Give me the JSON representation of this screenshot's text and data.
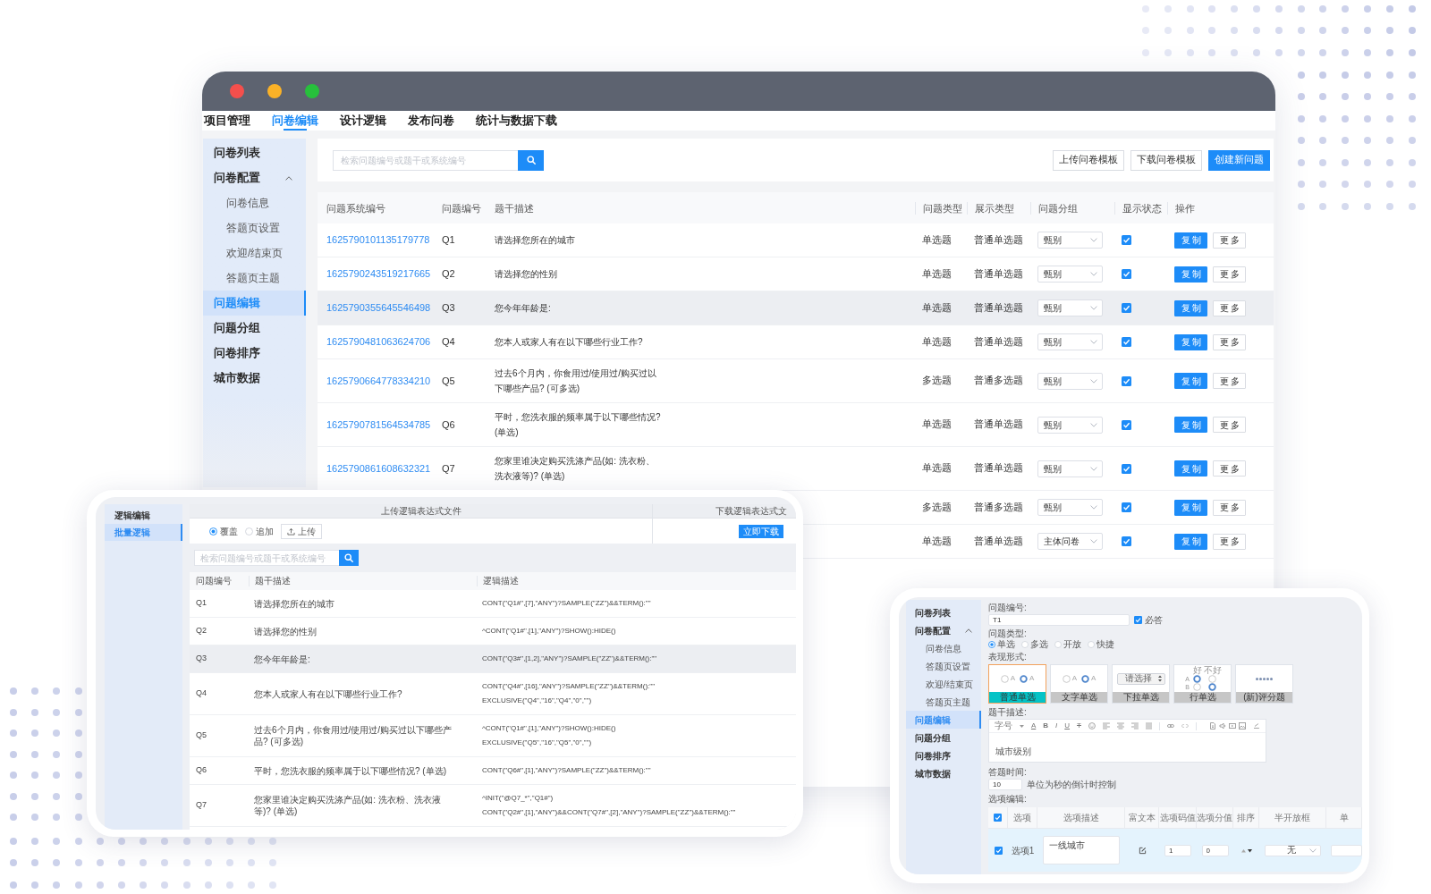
{
  "main_window": {
    "nav_tabs": [
      {
        "label": "项目管理",
        "selected": false
      },
      {
        "label": "问卷编辑",
        "selected": true
      },
      {
        "label": "设计逻辑",
        "selected": false
      },
      {
        "label": "发布问卷",
        "selected": false
      },
      {
        "label": "统计与数据下载",
        "selected": false
      }
    ],
    "sidebar": {
      "items": [
        {
          "label": "问卷列表",
          "selected": false
        },
        {
          "label": "问卷配置",
          "selected": false,
          "expanded": true,
          "children": [
            {
              "label": "问卷信息",
              "selected": false
            },
            {
              "label": "答题页设置",
              "selected": false
            },
            {
              "label": "欢迎/结束页",
              "selected": false
            },
            {
              "label": "答题页主题",
              "selected": false
            }
          ]
        },
        {
          "label": "问题编辑",
          "selected": true
        },
        {
          "label": "问题分组",
          "selected": false
        },
        {
          "label": "问卷排序",
          "selected": false
        },
        {
          "label": "城市数据",
          "selected": false
        }
      ]
    },
    "search": {
      "placeholder": "检索问题编号或题干或系统编号"
    },
    "toolbar_buttons": [
      {
        "label": "上传问卷模板",
        "kind": "default"
      },
      {
        "label": "下载问卷模板",
        "kind": "default"
      },
      {
        "label": "创建新问题",
        "kind": "primary"
      }
    ],
    "table": {
      "columns": [
        "问题系统编号",
        "问题编号",
        "题干描述",
        "问题类型",
        "展示类型",
        "问题分组",
        "显示状态",
        "操作"
      ],
      "rows": [
        {
          "system_id": "1625790101135179778",
          "number": "Q1",
          "description": "请选择您所在的城市",
          "type": "单选题",
          "display_type": "普通单选题",
          "group": "甄别",
          "checked": true,
          "highlighted": false,
          "actions": [
            {
              "label": "复制",
              "kind": "primary"
            },
            {
              "label": "更多",
              "kind": "default"
            }
          ]
        },
        {
          "system_id": "1625790243519217665",
          "number": "Q2",
          "description": "请选择您的性别",
          "type": "单选题",
          "display_type": "普通单选题",
          "group": "甄别",
          "checked": true,
          "highlighted": false,
          "actions": [
            {
              "label": "复制",
              "kind": "primary"
            },
            {
              "label": "更多",
              "kind": "default"
            }
          ]
        },
        {
          "system_id": "1625790355645546498",
          "number": "Q3",
          "description": "您今年年龄是:",
          "type": "单选题",
          "display_type": "普通单选题",
          "group": "甄别",
          "checked": true,
          "highlighted": true,
          "actions": [
            {
              "label": "复制",
              "kind": "primary"
            },
            {
              "label": "更多",
              "kind": "default"
            }
          ]
        },
        {
          "system_id": "1625790481063624706",
          "number": "Q4",
          "description": "您本人或家人有在以下哪些行业工作?",
          "type": "单选题",
          "display_type": "普通单选题",
          "group": "甄别",
          "checked": true,
          "highlighted": false,
          "actions": [
            {
              "label": "复制",
              "kind": "primary"
            },
            {
              "label": "更多",
              "kind": "default"
            }
          ]
        },
        {
          "system_id": "1625790664778334210",
          "number": "Q5",
          "description": "过去6个月内，你食用过/使用过/购买过以下哪些产品? (可多选)",
          "type": "多选题",
          "display_type": "普通多选题",
          "group": "甄别",
          "checked": true,
          "highlighted": false,
          "actions": [
            {
              "label": "复制",
              "kind": "primary"
            },
            {
              "label": "更多",
              "kind": "default"
            }
          ]
        },
        {
          "system_id": "1625790781564534785",
          "number": "Q6",
          "description": "平时，您洗衣服的频率属于以下哪些情况? (单选)",
          "type": "单选题",
          "display_type": "普通单选题",
          "group": "甄别",
          "checked": true,
          "highlighted": false,
          "actions": [
            {
              "label": "复制",
              "kind": "primary"
            },
            {
              "label": "更多",
              "kind": "default"
            }
          ]
        },
        {
          "system_id": "1625790861608632321",
          "number": "Q7",
          "description": "您家里谁决定购买洗涤产品(如: 洗衣粉、洗衣液等)? (单选)",
          "type": "单选题",
          "display_type": "普通单选题",
          "group": "甄别",
          "checked": true,
          "highlighted": false,
          "actions": [
            {
              "label": "复制",
              "kind": "primary"
            },
            {
              "label": "更多",
              "kind": "default"
            }
          ]
        },
        {
          "type": "多选题",
          "display_type": "普通多选题",
          "group": "甄别",
          "checked": true,
          "highlighted": false,
          "actions": [
            {
              "label": "复制",
              "kind": "primary"
            },
            {
              "label": "更多",
              "kind": "default"
            }
          ]
        },
        {
          "type": "单选题",
          "display_type": "普通单选题",
          "group": "主体问卷",
          "checked": true,
          "highlighted": false,
          "actions": [
            {
              "label": "复制",
              "kind": "primary"
            },
            {
              "label": "更多",
              "kind": "default"
            }
          ]
        }
      ]
    }
  },
  "logic_window": {
    "sidebar": {
      "items": [
        {
          "label": "逻辑编辑",
          "selected": false
        },
        {
          "label": "批量逻辑",
          "selected": true
        }
      ]
    },
    "upload_panel": {
      "title": "上传逻辑表达式文件",
      "modes": [
        {
          "label": "覆盖",
          "selected": true
        },
        {
          "label": "追加",
          "selected": false
        }
      ],
      "button": "上传"
    },
    "download_panel": {
      "title": "下载逻辑表达式文",
      "button": "立即下载"
    },
    "search": {
      "placeholder": "检索问题编号或题干或系统编号"
    },
    "table": {
      "columns": [
        "问题编号",
        "题干描述",
        "逻辑描述"
      ],
      "rows": [
        {
          "number": "Q1",
          "description": "请选择您所在的城市",
          "logic": [
            "CONT(\"Q1#\",[7],\"ANY\")?SAMPLE(\"ZZ\")&&TERM():\"\""
          ],
          "highlighted": false
        },
        {
          "number": "Q2",
          "description": "请选择您的性别",
          "logic": [
            "^CONT(\"Q1#\",[1],\"ANY\")?SHOW():HIDE()"
          ],
          "highlighted": false
        },
        {
          "number": "Q3",
          "description": "您今年年龄是:",
          "logic": [
            "CONT(\"Q3#\",[1,2],\"ANY\")?SAMPLE(\"ZZ\")&&TERM():\"\""
          ],
          "highlighted": true
        },
        {
          "number": "Q4",
          "description": "您本人或家人有在以下哪些行业工作?",
          "logic": [
            "CONT(\"Q4#\",[16],\"ANY\")?SAMPLE(\"ZZ\")&&TERM():\"\"",
            "EXCLUSIVE(\"Q4\",\"16\",\"Q4\",\"0\",\"\")"
          ],
          "highlighted": false
        },
        {
          "number": "Q5",
          "description": "过去6个月内，你食用过/使用过/购买过以下哪些产品? (可多选)",
          "logic": [
            "^CONT(\"Q1#\",[1],\"ANY\")?SHOW():HIDE()",
            "EXCLUSIVE(\"Q5\",\"16\",\"Q5\",\"0\",\"\")"
          ],
          "highlighted": false
        },
        {
          "number": "Q6",
          "description": "平时，您洗衣服的频率属于以下哪些情况? (单选)",
          "logic": [
            "CONT(\"Q6#\",[1],\"ANY\")?SAMPLE(\"ZZ\")&&TERM():\"\""
          ],
          "highlighted": false
        },
        {
          "number": "Q7",
          "description": "您家里谁决定购买洗涤产品(如: 洗衣粉、洗衣液等)? (单选)",
          "logic": [
            "^INIT(\"@Q7_*\",\"Q1#\")",
            "CONT(\"Q2#\",[1],\"ANY\")&&CONT(\"Q7#\",[2],\"ANY\")?SAMPLE(\"ZZ\")&&TERM():\"\""
          ],
          "highlighted": false
        }
      ]
    }
  },
  "editor_window": {
    "sidebar": {
      "items": [
        {
          "label": "问卷列表",
          "selected": false
        },
        {
          "label": "问卷配置",
          "selected": false,
          "expanded": true,
          "children": [
            {
              "label": "问卷信息",
              "selected": false
            },
            {
              "label": "答题页设置",
              "selected": false
            },
            {
              "label": "欢迎/结束页",
              "selected": false
            },
            {
              "label": "答题页主题",
              "selected": false
            }
          ]
        },
        {
          "label": "问题编辑",
          "selected": true
        },
        {
          "label": "问题分组",
          "selected": false
        },
        {
          "label": "问卷排序",
          "selected": false
        },
        {
          "label": "城市数据",
          "selected": false
        }
      ]
    },
    "question_number": {
      "label": "问题编号:",
      "value": "T1"
    },
    "required": {
      "label": "必答",
      "checked": true
    },
    "question_type": {
      "label": "问题类型:",
      "options": [
        {
          "label": "单选",
          "selected": true
        },
        {
          "label": "多选",
          "selected": false
        },
        {
          "label": "开放",
          "selected": false
        },
        {
          "label": "快捷",
          "selected": false
        }
      ]
    },
    "presentation": {
      "label": "表现形式:",
      "cards": [
        {
          "kind": "radio",
          "label": "普通单选",
          "selected": true,
          "preview": [
            "A",
            "A"
          ]
        },
        {
          "kind": "radio",
          "label": "文字单选",
          "selected": false,
          "preview": [
            "A",
            "A"
          ]
        },
        {
          "kind": "dropdown",
          "label": "下拉单选",
          "selected": false,
          "preview": [
            "请选择"
          ]
        },
        {
          "kind": "matrix",
          "label": "行单选",
          "selected": false,
          "preview": [
            "好",
            "不好",
            "A",
            "B"
          ]
        },
        {
          "kind": "rating",
          "label": "(新)评分题",
          "selected": false
        }
      ]
    },
    "stem": {
      "label": "题干描述:",
      "toolbar": [
        {
          "kind": "label",
          "text": "字号"
        },
        {
          "kind": "color",
          "text": "A"
        },
        {
          "kind": "bold",
          "text": "B"
        },
        {
          "kind": "italic",
          "text": "I"
        },
        {
          "kind": "underline",
          "text": "U"
        },
        {
          "kind": "strike",
          "text": "T"
        }
      ],
      "value": "城市级别"
    },
    "answer_time": {
      "label": "答题时间:",
      "value": "10",
      "note": "单位为秒的倒计时控制"
    },
    "options": {
      "label": "选项编辑:",
      "all_checked": true,
      "columns": [
        "选项",
        "选项描述",
        "富文本",
        "选项码值",
        "选项分值",
        "排序",
        "半开放框",
        "单"
      ],
      "rows": [
        {
          "checked": true,
          "label": "选项1",
          "description": "一线城市",
          "code": "1",
          "score": "0",
          "open_box": "无"
        }
      ]
    }
  }
}
